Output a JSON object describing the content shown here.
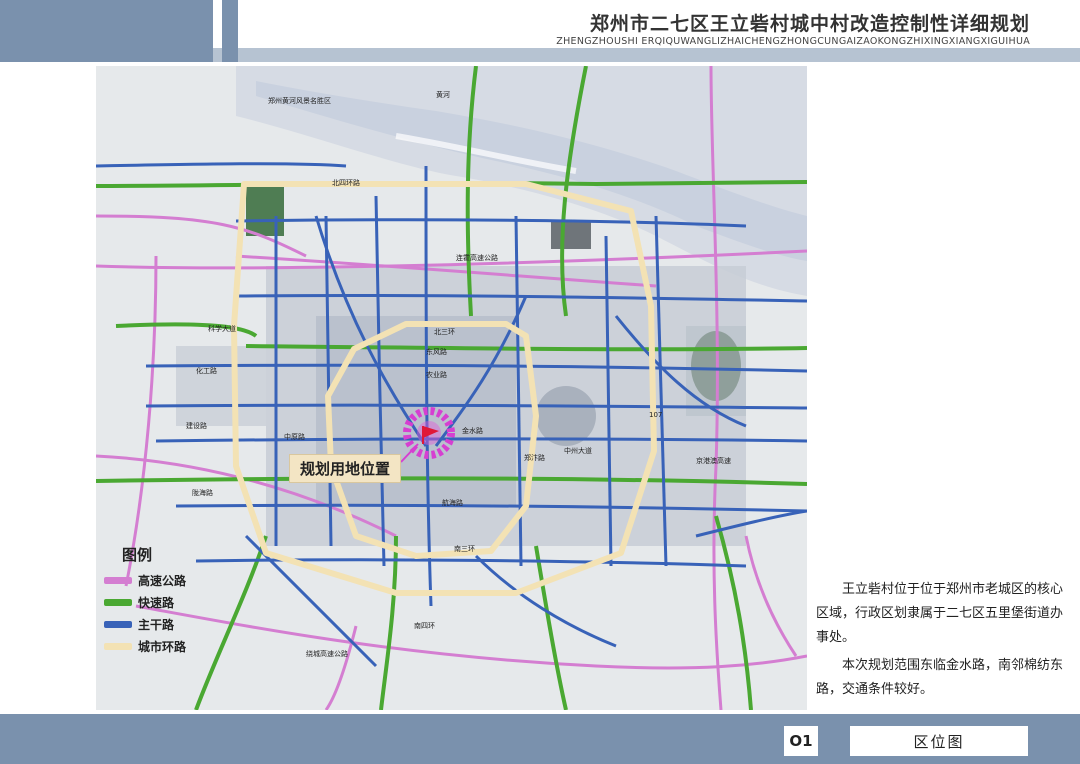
{
  "header": {
    "title": "郑州市二七区王立砦村城中村改造控制性详细规划",
    "subtitle": "ZHENGZHOUSHI ERQIQUWANGLIZHAICHENGZHONGCUNGAIZAOKONGZHIXINGXIANGXIGUIHUA"
  },
  "map": {
    "site_label": "规划用地位置",
    "road_labels": [
      "郑州黄河风景名胜区",
      "北四环路",
      "连霍高速公路",
      "北三环",
      "东风路",
      "农业路",
      "科学大道",
      "中原路",
      "建设路",
      "陇海路",
      "金水路",
      "郑汴路",
      "南三环",
      "航海路",
      "南四环",
      "京港澳高速",
      "107",
      "绕城高速公路",
      "中州大道",
      "化工路",
      "黄河"
    ]
  },
  "legend": {
    "title": "图例",
    "items": [
      {
        "label": "高速公路",
        "color": "#d47ed1"
      },
      {
        "label": "快速路",
        "color": "#4aa832"
      },
      {
        "label": "主干路",
        "color": "#3862b8"
      },
      {
        "label": "城市环路",
        "color": "#f3e2b4"
      }
    ]
  },
  "description": {
    "para1": "王立砦村位于位于郑州市老城区的核心区域，行政区划隶属于二七区五里堡街道办事处。",
    "para2": "本次规划范围东临金水路，南邻棉纺东路，交通条件较好。"
  },
  "footer": {
    "page_number": "O1",
    "page_name": "区位图"
  }
}
